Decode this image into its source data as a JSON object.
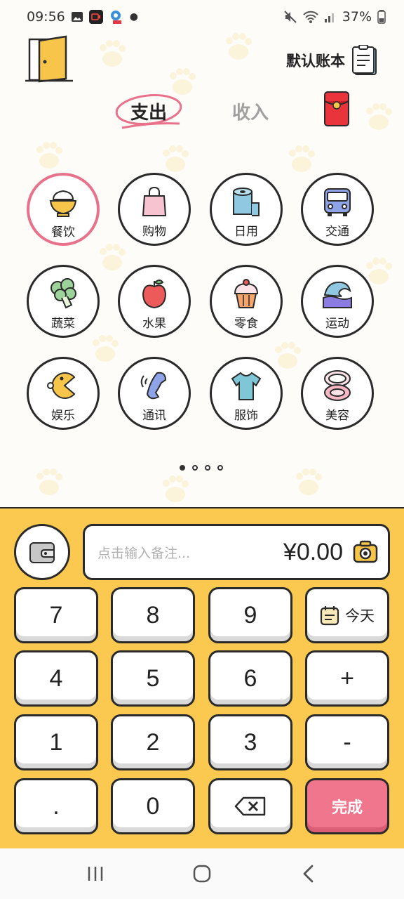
{
  "status_bar": {
    "time": "09:56",
    "battery": "37%"
  },
  "header": {
    "book_label": "默认账本"
  },
  "tabs": {
    "expense": "支出",
    "income": "收入"
  },
  "categories": [
    {
      "label": "餐饮",
      "icon": "rice-bowl-icon",
      "active": true
    },
    {
      "label": "购物",
      "icon": "shopping-bag-icon"
    },
    {
      "label": "日用",
      "icon": "tissue-roll-icon"
    },
    {
      "label": "交通",
      "icon": "bus-icon"
    },
    {
      "label": "蔬菜",
      "icon": "broccoli-icon"
    },
    {
      "label": "水果",
      "icon": "apple-icon"
    },
    {
      "label": "零食",
      "icon": "cupcake-icon"
    },
    {
      "label": "运动",
      "icon": "wave-icon"
    },
    {
      "label": "娱乐",
      "icon": "pacman-icon"
    },
    {
      "label": "通讯",
      "icon": "phone-icon"
    },
    {
      "label": "服饰",
      "icon": "tshirt-icon"
    },
    {
      "label": "美容",
      "icon": "compact-mirror-icon"
    }
  ],
  "pagination": {
    "pages": 4,
    "current": 1
  },
  "entry": {
    "note_placeholder": "点击输入备注...",
    "amount": "¥0.00"
  },
  "keypad": {
    "k7": "7",
    "k8": "8",
    "k9": "9",
    "today": "今天",
    "k4": "4",
    "k5": "5",
    "k6": "6",
    "plus": "+",
    "k1": "1",
    "k2": "2",
    "k3": "3",
    "minus": "-",
    "dot": ".",
    "k0": "0",
    "done": "完成"
  },
  "colors": {
    "panel": "#fbc94f",
    "active_ring": "#e8728b",
    "done_button": "#f0768d"
  }
}
